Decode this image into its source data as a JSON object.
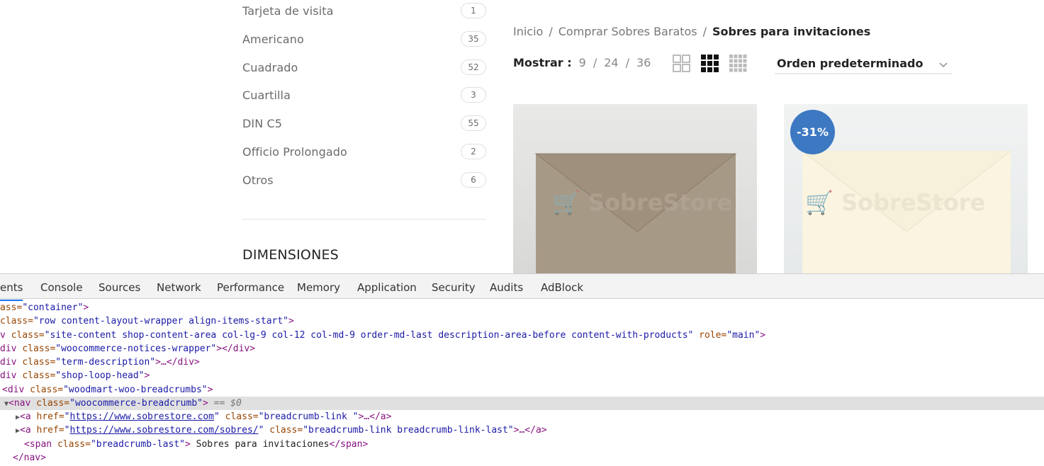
{
  "sidebar": {
    "categories": [
      {
        "label": "Tarjeta de visita",
        "count": "1"
      },
      {
        "label": "Americano",
        "count": "35"
      },
      {
        "label": "Cuadrado",
        "count": "52"
      },
      {
        "label": "Cuartilla",
        "count": "3"
      },
      {
        "label": "DIN C5",
        "count": "55"
      },
      {
        "label": "Officio Prolongado",
        "count": "2"
      },
      {
        "label": "Otros",
        "count": "6"
      }
    ],
    "dimensions_title": "DIMENSIONES"
  },
  "breadcrumb": {
    "home": "Inicio",
    "parent": "Comprar Sobres Baratos",
    "separator": "/",
    "current": "Sobres para invitaciones"
  },
  "shop_toolbar": {
    "show_label": "Mostrar :",
    "per_page_options": [
      "9",
      "24",
      "36"
    ],
    "per_page_separator": "/",
    "view_icons": [
      "grid-2-icon",
      "grid-3-icon",
      "grid-4-icon"
    ],
    "orderby_value": "Orden predeterminado"
  },
  "products": [
    {
      "image_color": "#a89a85",
      "watermark": "SobreStore"
    },
    {
      "image_color": "#f7f1dc",
      "watermark": "SobreStore",
      "badge": "-31%"
    }
  ],
  "devtools": {
    "tabs": [
      "ents",
      "Console",
      "Sources",
      "Network",
      "Performance",
      "Memory",
      "Application",
      "Security",
      "Audits",
      "AdBlock"
    ],
    "active_tab": "ents",
    "lines": {
      "l1_a": "ass=",
      "l1_v": "\"container\"",
      "l1_t": ">",
      "l2_a": "class=",
      "l2_v": "\"row content-layout-wrapper align-items-start\"",
      "l2_t": ">",
      "l3_t1": "v ",
      "l3_a1": "class=",
      "l3_v1": "\"site-content shop-content-area col-lg-9 col-12 col-md-9 order-md-last description-area-before content-with-products\"",
      "l3_a2": " role=",
      "l3_v2": "\"main\"",
      "l3_t2": ">",
      "l4_t1": "div ",
      "l4_a": "class=",
      "l4_v": "\"woocommerce-notices-wrapper\"",
      "l4_t2": "></div>",
      "l5_t1": "div ",
      "l5_a": "class=",
      "l5_v": "\"term-description\"",
      "l5_t2": ">…</div>",
      "l6_t1": "div ",
      "l6_a": "class=",
      "l6_v": "\"shop-loop-head\"",
      "l6_t2": ">",
      "l7_t1": "<div ",
      "l7_a": "class=",
      "l7_v": "\"woodmart-woo-breadcrumbs\"",
      "l7_t2": ">",
      "l8_tri": "▼",
      "l8_t1": "<nav ",
      "l8_a": "class=",
      "l8_v": "\"woocommerce-breadcrumb\"",
      "l8_t2": ">",
      "l8_d": " == $0",
      "l9_tri": "▶",
      "l9_t1": "<a ",
      "l9_a1": "href=",
      "l9_q1": "\"",
      "l9_link": "https://www.sobrestore.com",
      "l9_q2": "\"",
      "l9_a2": " class=",
      "l9_v": "\"breadcrumb-link \"",
      "l9_t2": ">…</a>",
      "l10_tri": "▶",
      "l10_t1": "<a ",
      "l10_a1": "href=",
      "l10_q1": "\"",
      "l10_link": "https://www.sobrestore.com/sobres/",
      "l10_q2": "\"",
      "l10_a2": " class=",
      "l10_v": "\"breadcrumb-link breadcrumb-link-last\"",
      "l10_t2": ">…</a>",
      "l11_t1": "<span ",
      "l11_a": "class=",
      "l11_v": "\"breadcrumb-last\"",
      "l11_t2": ">",
      "l11_txt": " Sobres para invitaciones",
      "l11_t3": "</span>",
      "l12_t": "</nav>"
    }
  }
}
